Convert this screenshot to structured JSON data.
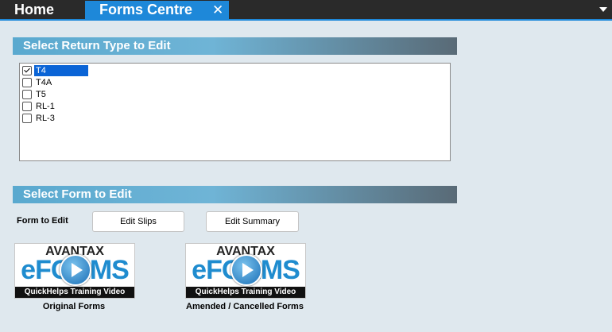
{
  "tabs": {
    "home": "Home",
    "forms_centre": "Forms Centre",
    "close_glyph": "✕"
  },
  "return_type": {
    "header": "Select Return Type to Edit",
    "items": [
      {
        "label": "T4",
        "checked": true,
        "selected": true
      },
      {
        "label": "T4A",
        "checked": false,
        "selected": false
      },
      {
        "label": "T5",
        "checked": false,
        "selected": false
      },
      {
        "label": "RL-1",
        "checked": false,
        "selected": false
      },
      {
        "label": "RL-3",
        "checked": false,
        "selected": false
      }
    ]
  },
  "form_edit": {
    "header": "Select Form to Edit",
    "label": "Form to Edit",
    "edit_slips": "Edit Slips",
    "edit_summary": "Edit Summary"
  },
  "videos": [
    {
      "logo": "AVANTAX",
      "product": "eFORMS",
      "caption": "QuickHelps Training Video",
      "label": "Original Forms"
    },
    {
      "logo": "AVANTAX",
      "product": "eFORMS",
      "caption": "QuickHelps Training Video",
      "label": "Amended / Cancelled Forms"
    }
  ],
  "colors": {
    "accent": "#1e88d9",
    "background": "#dfe8ee",
    "tabbar": "#2a2a2a",
    "selection": "#0a64d6"
  }
}
